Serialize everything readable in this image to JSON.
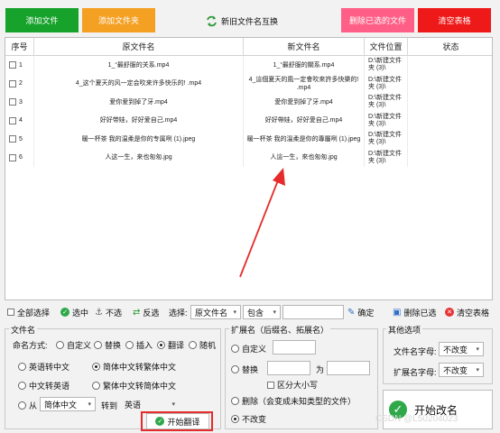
{
  "toolbar": {
    "add_file": "添加文件",
    "add_folder": "添加文件夹",
    "swap_names": "新旧文件名互换",
    "delete_selected": "删除已选的文件",
    "clear_table": "清空表格"
  },
  "table": {
    "headers": [
      "序号",
      "原文件名",
      "新文件名",
      "文件位置",
      "状态"
    ],
    "rows": [
      {
        "no": "1",
        "orig": "1_“最舒服的关系.mp4",
        "new": "1_“最舒服的關系.mp4",
        "loc": "D:\\新建文件夹 (3)\\",
        "status": ""
      },
      {
        "no": "2",
        "orig": "4_这个夏天的风一定会吹来许多快乐的! .mp4",
        "new": "4_這個夏天的風一定會吹來許多快樂的! .mp4",
        "loc": "D:\\新建文件夹 (3)\\",
        "status": ""
      },
      {
        "no": "3",
        "orig": "爱你爱到掉了牙.mp4",
        "new": "愛你愛到掉了牙.mp4",
        "loc": "D:\\新建文件夹 (3)\\",
        "status": ""
      },
      {
        "no": "4",
        "orig": "好好带娃，好好爱自己.mp4",
        "new": "好好帶娃，好好愛自己.mp4",
        "loc": "D:\\新建文件夹 (3)\\",
        "status": ""
      },
      {
        "no": "5",
        "orig": "暖一杯茶 我的温柔是你的专属咧 (1).jpeg",
        "new": "暖一杯茶 我的溫柔是你的專屬咧 (1).jpeg",
        "loc": "D:\\新建文件夹 (3)\\",
        "status": ""
      },
      {
        "no": "6",
        "orig": "人这一生，来也匆匆.jpg",
        "new": "人這一生，來也匆匆.jpg",
        "loc": "D:\\新建文件夹 (3)\\",
        "status": ""
      }
    ]
  },
  "selection_bar": {
    "select_all": "全部选择",
    "select": "选中",
    "unselect": "不选",
    "invert": "反选",
    "choose_label": "选择:",
    "field_value": "原文件名",
    "match_value": "包含",
    "keyword_value": "",
    "confirm": "确定",
    "delete_selected": "删除已选",
    "clear_table": "清空表格"
  },
  "filename_group": {
    "title": "文件名",
    "mode_label": "命名方式:",
    "modes": [
      "自定义",
      "替换",
      "插入",
      "翻译",
      "随机"
    ],
    "active_mode": "翻译",
    "translations": [
      "英语转中文",
      "简体中文转繁体中文",
      "中文转英语",
      "繁体中文转简体中文"
    ],
    "active_translation": "简体中文转繁体中文",
    "from_label": "从",
    "from_value": "简体中文",
    "to_label": "转到",
    "to_value": "英语",
    "start_translate": "开始翻译"
  },
  "ext_group": {
    "title": "扩展名（后缀名、拓展名）",
    "custom": "自定义",
    "replace": "替换",
    "to_label": "为",
    "case_label": "区分大小写",
    "delete_label": "删除（会变成未知类型的文件）",
    "no_change": "不改变",
    "active": "不改变"
  },
  "other_group": {
    "title": "其他选项",
    "filename_case_label": "文件名字母:",
    "filename_case_value": "不改变",
    "ext_case_label": "扩展名字母:",
    "ext_case_value": "不改变"
  },
  "start_button": "开始改名",
  "watermark": "CSDN @L50204023",
  "colors": {
    "green": "#17a22c",
    "orange": "#f4a023",
    "pink": "#ff5f86",
    "red": "#ee1a1a",
    "highlight": "#e52b2b"
  }
}
